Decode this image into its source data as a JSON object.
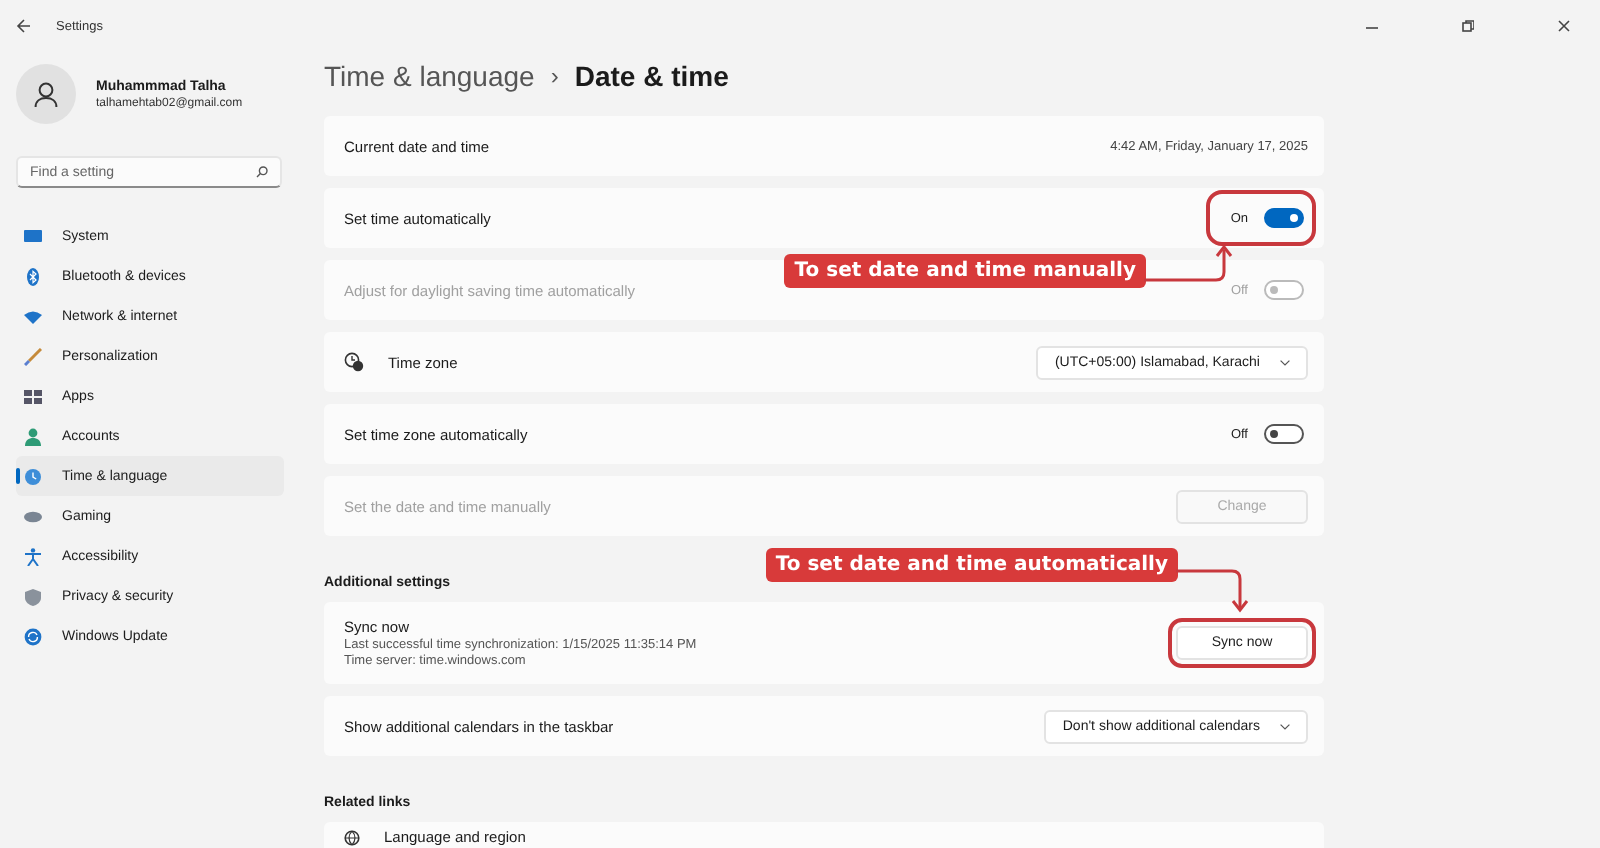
{
  "window": {
    "title": "Settings"
  },
  "user": {
    "name": "Muhammmad Talha",
    "email": "talhamehtab02@gmail.com"
  },
  "search": {
    "placeholder": "Find a setting"
  },
  "nav": [
    {
      "label": "System",
      "selected": false
    },
    {
      "label": "Bluetooth & devices",
      "selected": false
    },
    {
      "label": "Network & internet",
      "selected": false
    },
    {
      "label": "Personalization",
      "selected": false
    },
    {
      "label": "Apps",
      "selected": false
    },
    {
      "label": "Accounts",
      "selected": false
    },
    {
      "label": "Time & language",
      "selected": true
    },
    {
      "label": "Gaming",
      "selected": false
    },
    {
      "label": "Accessibility",
      "selected": false
    },
    {
      "label": "Privacy & security",
      "selected": false
    },
    {
      "label": "Windows Update",
      "selected": false
    }
  ],
  "breadcrumb": {
    "parent": "Time & language",
    "separator": "›",
    "current": "Date & time"
  },
  "rows": [
    {
      "kind": "value",
      "label": "Current date and time",
      "value": "4:42 AM, Friday, January 17, 2025",
      "disabled": false
    },
    {
      "kind": "toggle",
      "label": "Set time automatically",
      "state_text": "On",
      "on": true,
      "disabled": false,
      "highlighted": true,
      "callout": "To set date and time manually"
    },
    {
      "kind": "toggle",
      "label": "Adjust for daylight saving time automatically",
      "state_text": "Off",
      "on": false,
      "disabled": true
    },
    {
      "kind": "dropdown",
      "label": "Time zone",
      "value": "(UTC+05:00) Islamabad, Karachi",
      "with_icon": true,
      "disabled": false
    },
    {
      "kind": "toggle",
      "label": "Set time zone automatically",
      "state_text": "Off",
      "on": false,
      "disabled": false
    },
    {
      "kind": "button",
      "label": "Set the date and time manually",
      "button": "Change",
      "disabled": true
    }
  ],
  "additional": {
    "heading": "Additional settings",
    "sync": {
      "title": "Sync now",
      "lines": [
        "Last successful time synchronization: 1/15/2025 11:35:14 PM",
        "Time server: time.windows.com"
      ],
      "button": "Sync now",
      "highlighted": true,
      "callout": "To set date and time automatically"
    },
    "rows": [
      {
        "kind": "dropdown",
        "label": "Show additional calendars in the taskbar",
        "value": "Don't show additional calendars",
        "disabled": false
      }
    ]
  },
  "related": {
    "heading": "Related links",
    "links": [
      {
        "label": "Language and region"
      }
    ]
  }
}
